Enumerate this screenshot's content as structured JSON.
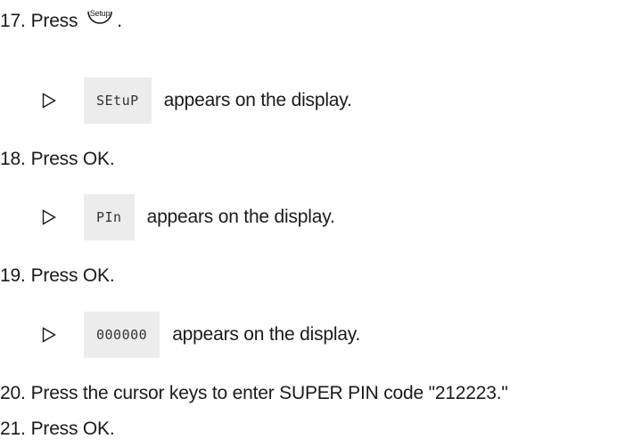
{
  "steps": [
    {
      "number": "17.",
      "text_before_icon": "Press",
      "icon_label": "Setup",
      "text_after_icon": "."
    },
    {
      "number": "18.",
      "text": "Press OK."
    },
    {
      "number": "19.",
      "text": "Press OK."
    },
    {
      "number": "20.",
      "text": "Press the cursor keys to enter SUPER PIN code \"212223.\""
    },
    {
      "number": "21.",
      "text": "Press OK."
    }
  ],
  "results": [
    {
      "display": "SEtuP",
      "text": "appears on the display."
    },
    {
      "display": "PIn",
      "text": "appears on the display."
    },
    {
      "display": "000000",
      "text": "appears on the display."
    }
  ],
  "icons": {
    "result_marker": "triangle-right-icon",
    "setup_button": "setup-button-icon"
  }
}
